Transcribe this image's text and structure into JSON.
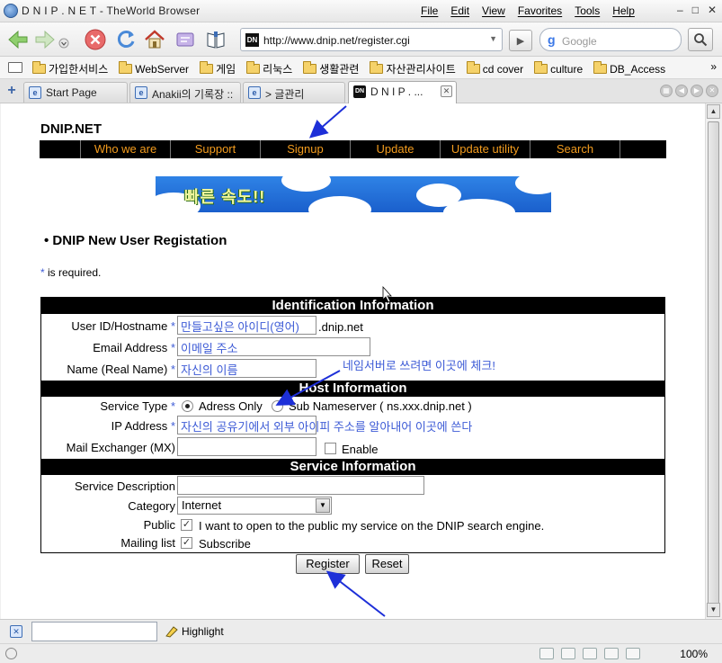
{
  "window": {
    "title": "D N I P . N E T - TheWorld Browser",
    "menu": [
      "File",
      "Edit",
      "View",
      "Favorites",
      "Tools",
      "Help"
    ],
    "controls": {
      "minimize": "–",
      "restore": "□",
      "close": "✕"
    }
  },
  "toolbar": {
    "address": "http://www.dnip.net/register.cgi",
    "address_favicon": "DN",
    "search_placeholder": "Google",
    "search_logo": "g"
  },
  "favorites": {
    "items": [
      "가입한서비스",
      "WebServer",
      "게임",
      "리눅스",
      "생활관련",
      "자산관리사이트",
      "cd cover",
      "culture",
      "DB_Access"
    ],
    "more": "»"
  },
  "tabs": [
    {
      "label": "Start Page",
      "active": false
    },
    {
      "label": "Anakii의 기록장 ::",
      "active": false
    },
    {
      "label": "> 글관리",
      "active": false
    },
    {
      "label": "D N I P . ...",
      "active": true
    }
  ],
  "site": {
    "title": "DNIP.NET",
    "nav": [
      "Who we are",
      "Support",
      "Signup",
      "Update",
      "Update utility",
      "Search"
    ],
    "banner_text": "빠른 속도!!",
    "heading": "DNIP New User Registation",
    "req_star": "*",
    "req_note": " is required."
  },
  "form": {
    "sections": {
      "identification": "Identification Information",
      "host": "Host Information",
      "service": "Service Information"
    },
    "user_id": {
      "label": "User ID/Hostname",
      "value": "만들고싶은 아이디(영어)",
      "suffix": ".dnip.net"
    },
    "email": {
      "label": "Email Address",
      "value": "이메일 주소"
    },
    "name": {
      "label": "Name (Real Name)",
      "value": "자신의 이름"
    },
    "service_type": {
      "label": "Service Type",
      "option1": "Adress Only",
      "option2": "Sub Nameserver ( ns.xxx.dnip.net )",
      "selected": "Adress Only"
    },
    "ip": {
      "label": "IP Address",
      "value": "자신의 공유기에서 외부 아이피 주소를 알아내어 이곳에 쓴다"
    },
    "mx": {
      "label": "Mail Exchanger (MX)",
      "value": "",
      "enable_label": "Enable",
      "enable_checked": false
    },
    "service_desc": {
      "label": "Service Description",
      "value": ""
    },
    "category": {
      "label": "Category",
      "value": "Internet"
    },
    "public": {
      "label": "Public",
      "text": "I want to open to the public my service on the DNIP search engine.",
      "checked": true
    },
    "mailing": {
      "label": "Mailing list",
      "text": "Subscribe",
      "checked": true
    },
    "required_star": "*",
    "annotation": "네임서버로 쓰려면 이곳에 체크!",
    "register_label": "Register",
    "reset_label": "Reset"
  },
  "findbar": {
    "highlight_label": "Highlight",
    "value": ""
  },
  "status": {
    "zoom": "100%"
  },
  "colors": {
    "nav_text": "#f39c1e",
    "annotation_blue": "#3d5bd6",
    "section_bg": "#000000"
  }
}
